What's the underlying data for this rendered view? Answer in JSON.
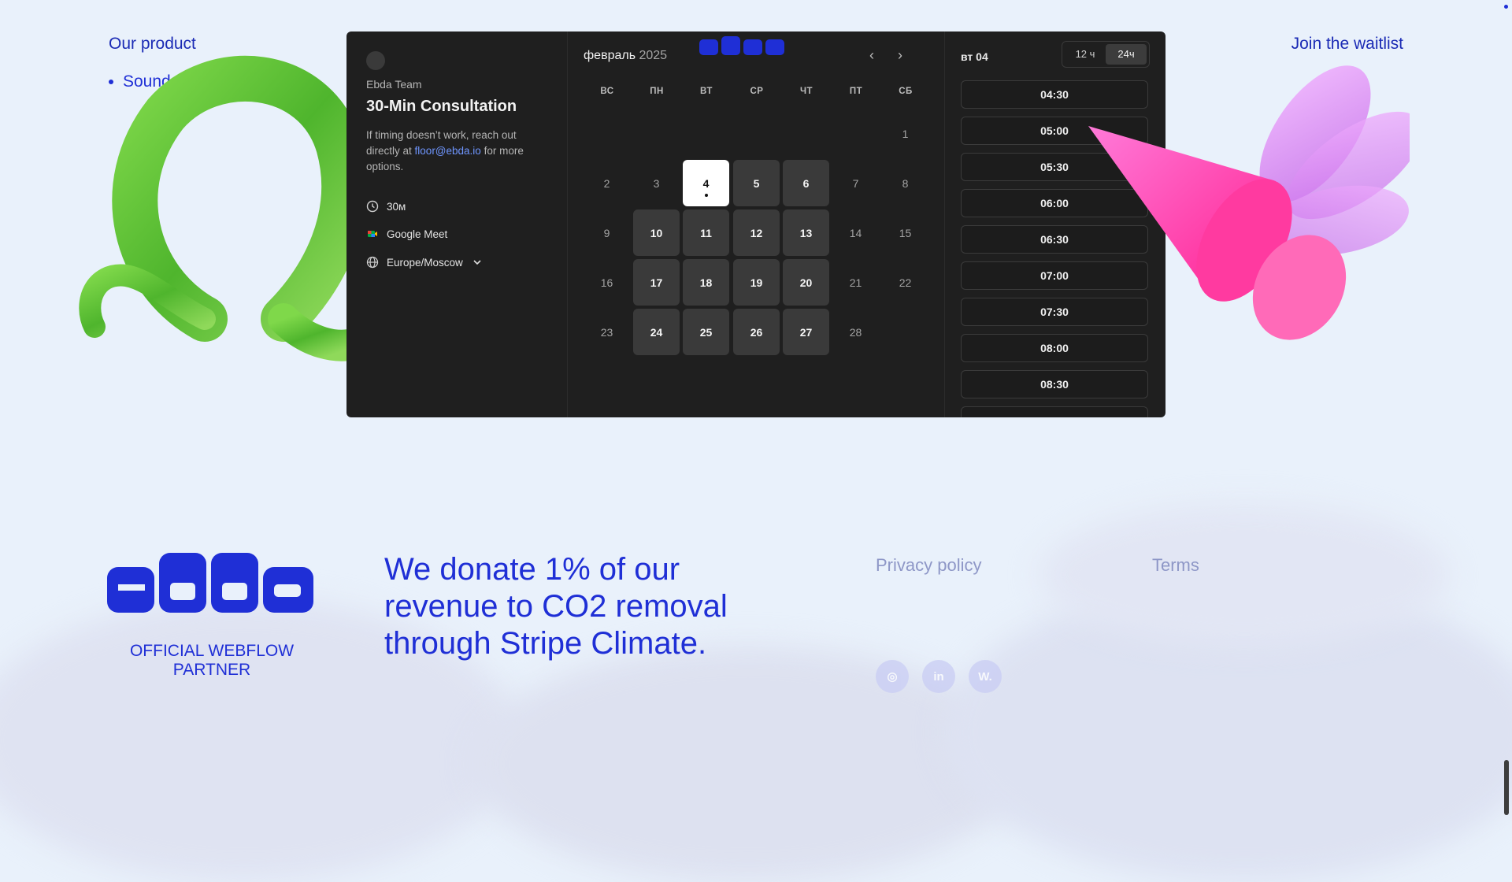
{
  "nav": {
    "product_label": "Our product",
    "items": [
      "Sound On"
    ],
    "waitlist_label": "Join the waitlist"
  },
  "booking": {
    "org": "Ebda Team",
    "title": "30-Min Consultation",
    "desc_pre": "If timing doesn’t work, reach out directly at",
    "desc_email": "floor@ebda.io",
    "desc_post": "for more options.",
    "duration": "30м",
    "platform": "Google Meet",
    "timezone": "Europe/Moscow",
    "month": "февраль",
    "year": "2025",
    "weekdays": [
      "ВС",
      "ПН",
      "ВТ",
      "СР",
      "ЧТ",
      "ПТ",
      "СБ"
    ],
    "days": [
      {
        "d": "1",
        "s": "off"
      },
      {
        "d": "2",
        "s": "off"
      },
      {
        "d": "3",
        "s": "off"
      },
      {
        "d": "4",
        "s": "sel"
      },
      {
        "d": "5",
        "s": "av"
      },
      {
        "d": "6",
        "s": "av"
      },
      {
        "d": "7",
        "s": "off"
      },
      {
        "d": "8",
        "s": "off"
      },
      {
        "d": "9",
        "s": "off"
      },
      {
        "d": "10",
        "s": "av"
      },
      {
        "d": "11",
        "s": "av"
      },
      {
        "d": "12",
        "s": "av"
      },
      {
        "d": "13",
        "s": "av"
      },
      {
        "d": "14",
        "s": "off"
      },
      {
        "d": "15",
        "s": "off"
      },
      {
        "d": "16",
        "s": "off"
      },
      {
        "d": "17",
        "s": "av"
      },
      {
        "d": "18",
        "s": "av"
      },
      {
        "d": "19",
        "s": "av"
      },
      {
        "d": "20",
        "s": "av"
      },
      {
        "d": "21",
        "s": "off"
      },
      {
        "d": "22",
        "s": "off"
      },
      {
        "d": "23",
        "s": "off"
      },
      {
        "d": "24",
        "s": "av"
      },
      {
        "d": "25",
        "s": "av"
      },
      {
        "d": "26",
        "s": "av"
      },
      {
        "d": "27",
        "s": "av"
      },
      {
        "d": "28",
        "s": "off"
      }
    ],
    "selected_date_label": "вт 04",
    "format_12": "12 ч",
    "format_24": "24ч",
    "format_active": "24ч",
    "slots": [
      "04:30",
      "05:00",
      "05:30",
      "06:00",
      "06:30",
      "07:00",
      "07:30",
      "08:00",
      "08:30"
    ]
  },
  "footer": {
    "partner_line1": "OFFICIAL WEBFLOW",
    "partner_line2": "PARTNER",
    "donate": "We donate 1% of our revenue to CO2 removal through Stripe Climate.",
    "privacy": "Privacy policy",
    "terms": "Terms",
    "social": [
      {
        "name": "instagram-icon",
        "glyph": "◎"
      },
      {
        "name": "linkedin-icon",
        "glyph": "in"
      },
      {
        "name": "webflow-icon",
        "glyph": "W."
      }
    ]
  },
  "colors": {
    "brand_blue": "#1f2fd6",
    "widget_bg": "#1f1f1f",
    "available_day": "#3a3a3a",
    "selected_day": "#ffffff",
    "link": "#6f96ff"
  }
}
